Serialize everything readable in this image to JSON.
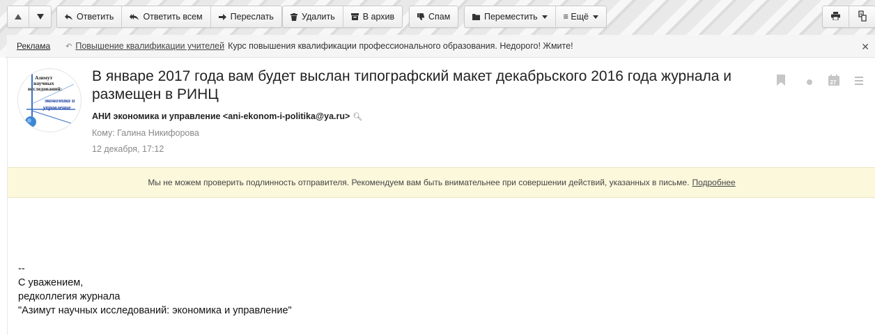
{
  "toolbar": {
    "reply": "Ответить",
    "reply_all": "Ответить всем",
    "forward": "Переслать",
    "delete": "Удалить",
    "archive": "В архив",
    "spam": "Спам",
    "move": "Переместить",
    "more": "≡ Ещё"
  },
  "ad": {
    "label": "Реклама",
    "link": "Повышение квалификации учителей",
    "text": "Курс повышения квалификации профессионального образования. Недорого! Жмите!"
  },
  "message": {
    "subject": "В январе 2017 года вам будет выслан типографский макет декабрьского 2016 года журнала и размещен в РИНЦ",
    "from": "АНИ экономика и управление <ani-ekonom-i-politika@ya.ru>",
    "to": "Кому: Галина Никифорова",
    "date": "12 декабря, 17:12",
    "calendar_day": "27"
  },
  "avatar": {
    "line1": "Азимут",
    "line2": "научных",
    "line3": "исследований:",
    "line4": "экономика и",
    "line5": "управление"
  },
  "warning": {
    "text": "Мы не можем проверить подлинность отправителя. Рекомендуем вам быть внимательнее при совершении действий, указанных в письме.",
    "link": "Подробнее"
  },
  "body": {
    "line1": "--",
    "line2": "С уважением,",
    "line3": "редколлегия журнала",
    "line4": "\"Азимут научных исследований: экономика и управление\""
  },
  "colors": {
    "warning_bg": "#fcf8dc",
    "ad_bg": "#f5f5f5"
  }
}
